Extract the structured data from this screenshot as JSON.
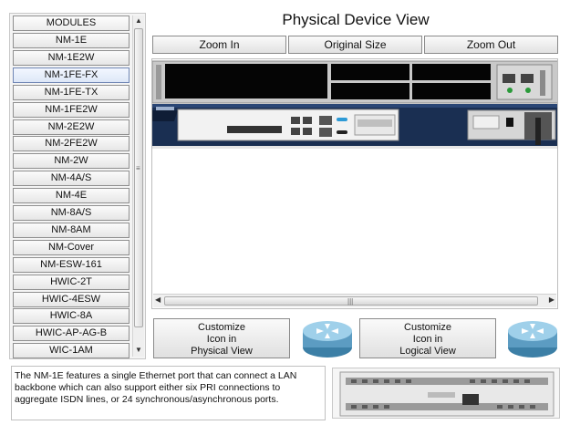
{
  "modules": {
    "header": "MODULES",
    "items": [
      "NM-1E",
      "NM-1E2W",
      "NM-1FE-FX",
      "NM-1FE-TX",
      "NM-1FE2W",
      "NM-2E2W",
      "NM-2FE2W",
      "NM-2W",
      "NM-4A/S",
      "NM-4E",
      "NM-8A/S",
      "NM-8AM",
      "NM-Cover",
      "NM-ESW-161",
      "HWIC-2T",
      "HWIC-4ESW",
      "HWIC-8A",
      "HWIC-AP-AG-B",
      "WIC-1AM"
    ],
    "selected": "NM-1FE-FX"
  },
  "title": "Physical Device View",
  "zoom": {
    "zoom_in": "Zoom In",
    "original": "Original Size",
    "zoom_out": "Zoom Out"
  },
  "customize": {
    "physical": [
      "Customize",
      "Icon in",
      "Physical View"
    ],
    "logical": [
      "Customize",
      "Icon in",
      "Logical View"
    ]
  },
  "description": "The NM-1E features a single Ethernet port that can connect a LAN backbone which can also support either six PRI connections to aggregate ISDN lines, or 24 synchronous/asynchronous ports.",
  "colors": {
    "router_body": "#1a2f52",
    "router_icon": "#6aa6c9",
    "panel_gray": "#9a9a9a"
  },
  "icons": [
    "router-icon",
    "scroll-up-icon",
    "scroll-down-icon",
    "scroll-left-icon",
    "scroll-right-icon",
    "grip-icon"
  ]
}
